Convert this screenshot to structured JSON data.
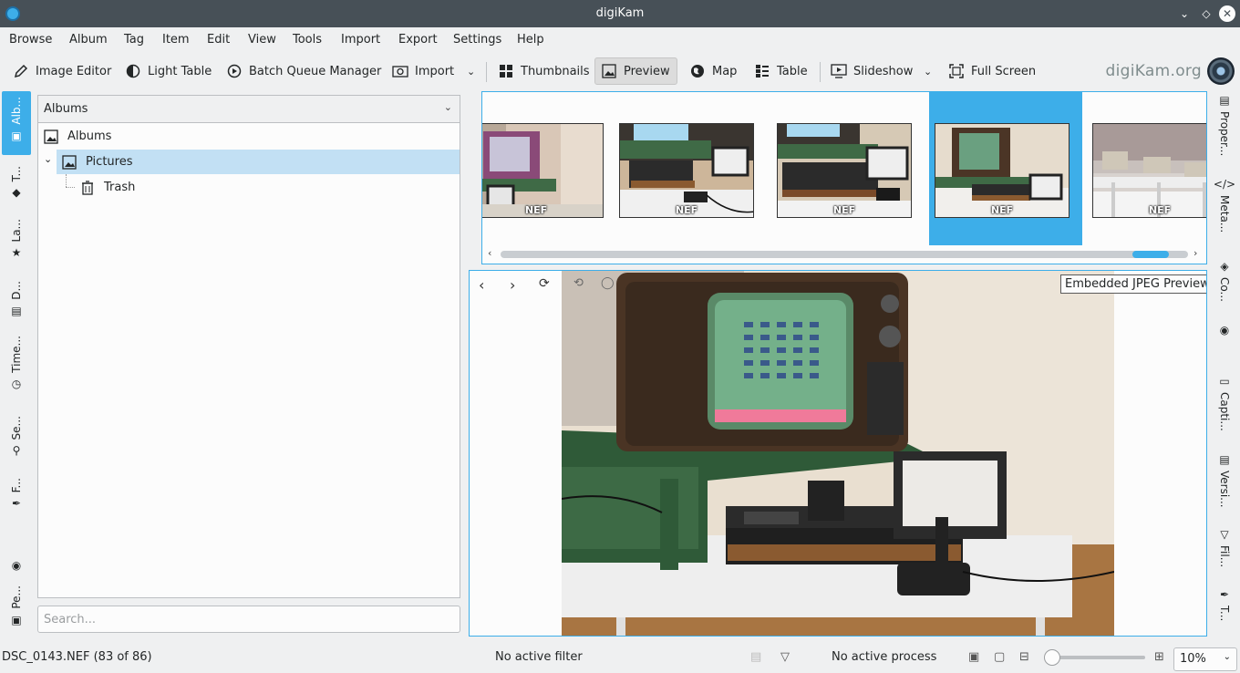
{
  "window": {
    "title": "digiKam"
  },
  "menu": [
    "Browse",
    "Album",
    "Tag",
    "Item",
    "Edit",
    "View",
    "Tools",
    "Import",
    "Export",
    "Settings",
    "Help"
  ],
  "toolbar": {
    "image_editor": "Image Editor",
    "light_table": "Light Table",
    "batch_queue": "Batch Queue Manager",
    "import": "Import",
    "thumbnails": "Thumbnails",
    "preview": "Preview",
    "map": "Map",
    "table": "Table",
    "slideshow": "Slideshow",
    "full_screen": "Full Screen",
    "brand": "digiKam.org"
  },
  "left_tabs": [
    "Alb...",
    "T...",
    "La...",
    "D...",
    "Time...",
    "Se...",
    "F...",
    "Pe..."
  ],
  "albums": {
    "combo_label": "Albums",
    "tree": [
      {
        "label": "Albums",
        "icon": "album-icon",
        "level": 0
      },
      {
        "label": "Pictures",
        "icon": "album-icon",
        "level": 1,
        "selected": true
      },
      {
        "label": "Trash",
        "icon": "trash-icon",
        "level": 2
      }
    ]
  },
  "search": {
    "placeholder": "Search..."
  },
  "thumbnails": [
    {
      "format": "NEF",
      "selected": false
    },
    {
      "format": "NEF",
      "selected": false
    },
    {
      "format": "NEF",
      "selected": false
    },
    {
      "format": "NEF",
      "selected": true
    },
    {
      "format": "NEF",
      "selected": false
    }
  ],
  "preview": {
    "badge": "Embedded JPEG Preview"
  },
  "right_tabs": [
    "Proper...",
    "Meta...",
    "Co...",
    "Capti...",
    "Versi...",
    "Fil...",
    "T..."
  ],
  "status": {
    "file": "DSC_0143.NEF (83 of 86)",
    "filter": "No active filter",
    "process": "No active process",
    "zoom": "10%",
    "zoom_level": 0.02
  },
  "colors": {
    "accent": "#3daee9",
    "titlebar": "#475057",
    "selection": "#c2e0f4"
  }
}
